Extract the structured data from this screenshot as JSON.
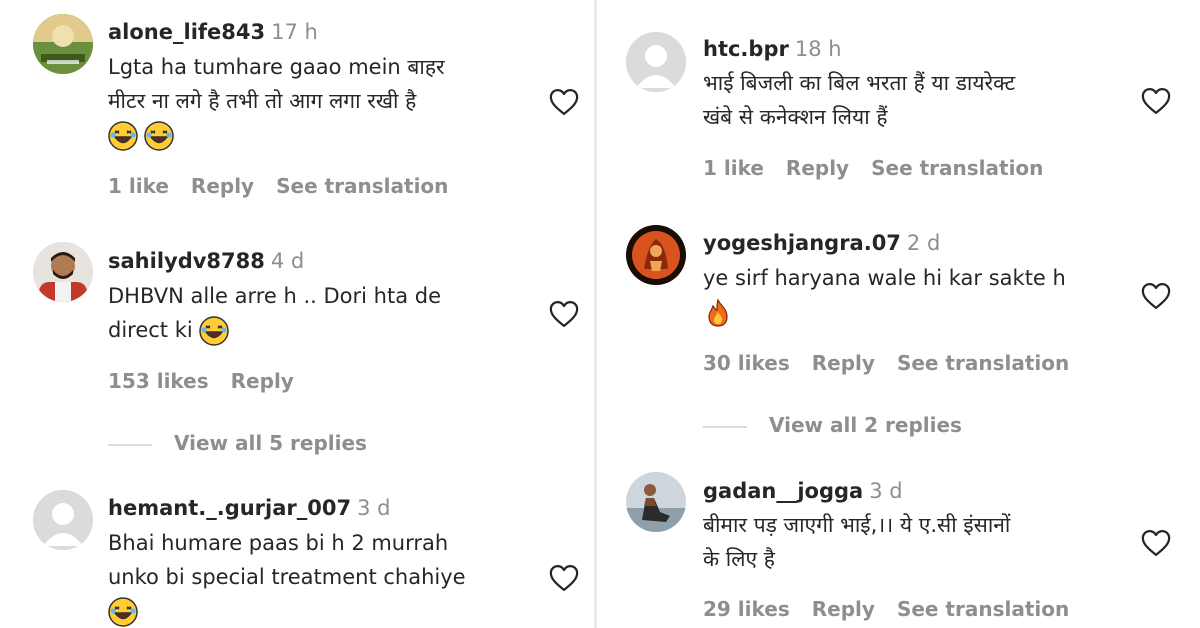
{
  "left": {
    "comments": [
      {
        "username": "alone_life843",
        "time": "17 h",
        "lines": [
          "Lgta ha tumhare gaao mein बाहर",
          "मीटर ना लगे है तभी तो आग लगा रखी है"
        ],
        "emojis": [
          "laughing-emoji",
          "laughing-emoji"
        ],
        "likes": "1 like",
        "reply": "Reply",
        "translation": "See translation"
      },
      {
        "username": "sahilydv8788",
        "time": "4 d",
        "lines": [
          "DHBVN alle arre h .. Dori hta de",
          "direct ki"
        ],
        "emojis": [
          "laughing-emoji"
        ],
        "likes": "153 likes",
        "reply": "Reply",
        "view_replies": "View all 5 replies"
      },
      {
        "username": "hemant._.gurjar_007",
        "time": "3 d",
        "lines": [
          "Bhai humare paas bi h 2 murrah",
          "unko bi special treatment chahiye"
        ],
        "emojis": [
          "laughing-emoji"
        ]
      }
    ]
  },
  "right": {
    "comments": [
      {
        "username": "htc.bpr",
        "time": "18 h",
        "lines": [
          "भाई बिजली का बिल भरता हैं या डायरेक्ट",
          "खंबे से कनेक्शन लिया हैं"
        ],
        "likes": "1 like",
        "reply": "Reply",
        "translation": "See translation"
      },
      {
        "username": "yogeshjangra.07",
        "time": "2 d",
        "lines": [
          "ye sirf haryana wale hi kar sakte h"
        ],
        "emojis": [
          "fire-emoji"
        ],
        "likes": "30 likes",
        "reply": "Reply",
        "translation": "See translation",
        "view_replies": "View all 2 replies"
      },
      {
        "username": "gadan__jogga",
        "time": "3 d",
        "lines": [
          "बीमार पड़ जाएगी भाई,।। ये ए.सी इंसानों",
          "के लिए है"
        ],
        "likes": "29 likes",
        "reply": "Reply",
        "translation": "See translation"
      }
    ]
  },
  "colors": {
    "text": "#262626",
    "muted": "#8e8e8e",
    "divider": "#dbdbdb"
  }
}
